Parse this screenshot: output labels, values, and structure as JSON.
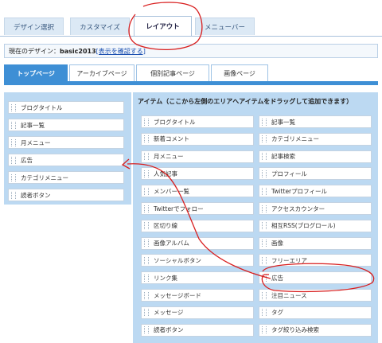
{
  "top_tabs": [
    {
      "label": "デザイン選択"
    },
    {
      "label": "カスタマイズ"
    },
    {
      "label": "レイアウト"
    },
    {
      "label": "メニューバー"
    }
  ],
  "current_design": {
    "prefix": "現在のデザイン：",
    "name": "basic2013",
    "link": "[表示を確認する]"
  },
  "sub_tabs": [
    {
      "label": "トップページ"
    },
    {
      "label": "アーカイブページ"
    },
    {
      "label": "個別記事ページ"
    },
    {
      "label": "画像ページ"
    }
  ],
  "left_items": [
    "ブログタイトル",
    "記事一覧",
    "月メニュー",
    "広告",
    "カテゴリメニュー",
    "読者ボタン"
  ],
  "items_title": "アイテム（ここから左側のエリアへアイテムをドラッグして追加できます）",
  "items_left": [
    "ブログタイトル",
    "新着コメント",
    "月メニュー",
    "人気記事",
    "メンバー一覧",
    "Twitterでフォロー",
    "区切り線",
    "画像アルバム",
    "ソーシャルボタン",
    "リンク集",
    "メッセージボード",
    "メッセージ",
    "読者ボタン"
  ],
  "items_right": [
    "記事一覧",
    "カテゴリメニュー",
    "記事検索",
    "プロフィール",
    "Twitterプロフィール",
    "アクセスカウンター",
    "相互RSS(ブログロール)",
    "画像",
    "フリーエリア",
    "広告",
    "注目ニュース",
    "タグ",
    "タグ絞り込み検索"
  ],
  "colors": {
    "accent": "#3e8fd5",
    "panel": "#bcd9f2",
    "annotation": "#d81e1e"
  }
}
